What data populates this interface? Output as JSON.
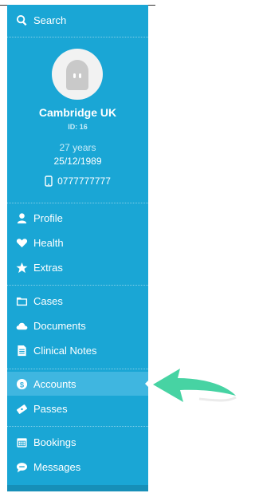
{
  "search": {
    "label": "Search"
  },
  "profile": {
    "name": "Cambridge UK",
    "id_label": "ID: 16",
    "age": "27 years",
    "dob": "25/12/1989",
    "phone": "0777777777"
  },
  "nav": {
    "profile": "Profile",
    "health": "Health",
    "extras": "Extras",
    "cases": "Cases",
    "documents": "Documents",
    "clinical_notes": "Clinical Notes",
    "accounts": "Accounts",
    "passes": "Passes",
    "bookings": "Bookings",
    "messages": "Messages"
  },
  "icons": {
    "search": "search-icon",
    "phone": "mobile-phone-icon",
    "profile": "user-icon",
    "health": "heart-icon",
    "extras": "star-icon",
    "cases": "folder-icon",
    "documents": "cloud-icon",
    "clinical_notes": "document-icon",
    "accounts": "dollar-icon",
    "passes": "ticket-icon",
    "bookings": "calendar-icon",
    "messages": "chat-icon"
  },
  "colors": {
    "sidebar": "#1aa6d5",
    "active": "#3fb6e0",
    "arrow": "#47d3a3"
  }
}
